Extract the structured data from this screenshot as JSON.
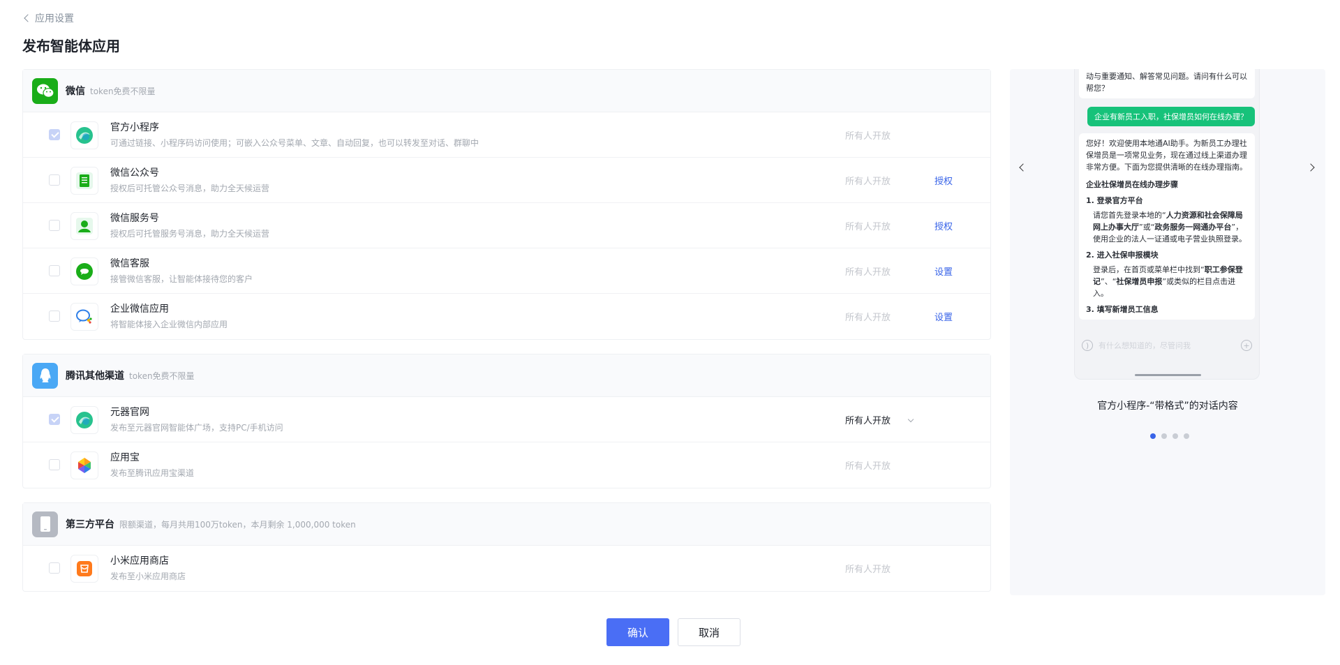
{
  "header": {
    "back_label": "应用设置",
    "title": "发布智能体应用"
  },
  "sections": [
    {
      "title": "微信",
      "subtitle": "token免费不限量",
      "rows": [
        {
          "title": "官方小程序",
          "desc": "可通过链接、小程序码访问使用；可嵌入公众号菜单、文章、自动回复，也可以转发至对话、群聊中",
          "access": "所有人开放",
          "action": "",
          "checked": true
        },
        {
          "title": "微信公众号",
          "desc": "授权后可托管公众号消息，助力全天候运营",
          "access": "所有人开放",
          "action": "授权",
          "checked": false
        },
        {
          "title": "微信服务号",
          "desc": "授权后可托管服务号消息，助力全天候运营",
          "access": "所有人开放",
          "action": "授权",
          "checked": false
        },
        {
          "title": "微信客服",
          "desc": "接管微信客服，让智能体接待您的客户",
          "access": "所有人开放",
          "action": "设置",
          "checked": false
        },
        {
          "title": "企业微信应用",
          "desc": "将智能体接入企业微信内部应用",
          "access": "所有人开放",
          "action": "设置",
          "checked": false
        }
      ]
    },
    {
      "title": "腾讯其他渠道",
      "subtitle": "token免费不限量",
      "rows": [
        {
          "title": "元器官网",
          "desc": "发布至元器官网智能体广场，支持PC/手机访问",
          "access": "所有人开放",
          "action": "",
          "checked": true
        },
        {
          "title": "应用宝",
          "desc": "发布至腾讯应用宝渠道",
          "access": "所有人开放",
          "action": "",
          "checked": false
        }
      ]
    },
    {
      "title": "第三方平台",
      "subtitle": "限额渠道，每月共用100万token，本月剩余 1,000,000 token",
      "rows": [
        {
          "title": "小米应用商店",
          "desc": "发布至小米应用商店",
          "access": "所有人开放",
          "action": "",
          "checked": false
        }
      ]
    }
  ],
  "buttons": {
    "confirm": "确认",
    "cancel": "取消"
  },
  "preview": {
    "msg_top": "动与重要通知、解答常见问题。请问有什么可以帮您？",
    "user_msg": "企业有新员工入职，社保增员如何在线办理？",
    "reply_intro": "您好！欢迎使用本地通AI助手。为新员工办理社保增员是一项常见业务，现在通过线上渠道办理非常方便。下面为您提供清晰的在线办理指南。",
    "reply_heading": "企业社保增员在线办理步骤",
    "step1_title": "1. 登录官方平台",
    "step1_a": "请您首先登录本地的“",
    "step1_b": "人力资源和社会保障局网上办事大厅",
    "step1_c": "”或“",
    "step1_d": "政务服务一网通办平台",
    "step1_e": "”，使用企业的法人一证通或电子营业执照登录。",
    "step2_title": "2. 进入社保申报模块",
    "step2_a": "登录后，在首页或菜单栏中找到“",
    "step2_b": "职工参保登记",
    "step2_c": "”、“",
    "step2_d": "社保增员申报",
    "step2_e": "”或类似的栏目点击进入。",
    "step3_title": "3. 填写新增员工信息",
    "input_placeholder": "有什么想知道的，尽管问我",
    "caption": "官方小程序-“带格式”的对话内容",
    "active_slide": 1,
    "total_slides": 4
  },
  "colors": {
    "primary": "#4a6ef5",
    "link": "#3964e8",
    "wechat_green": "#1aad19",
    "qq_blue": "#4aa8f5",
    "user_bubble": "#17c27a"
  }
}
